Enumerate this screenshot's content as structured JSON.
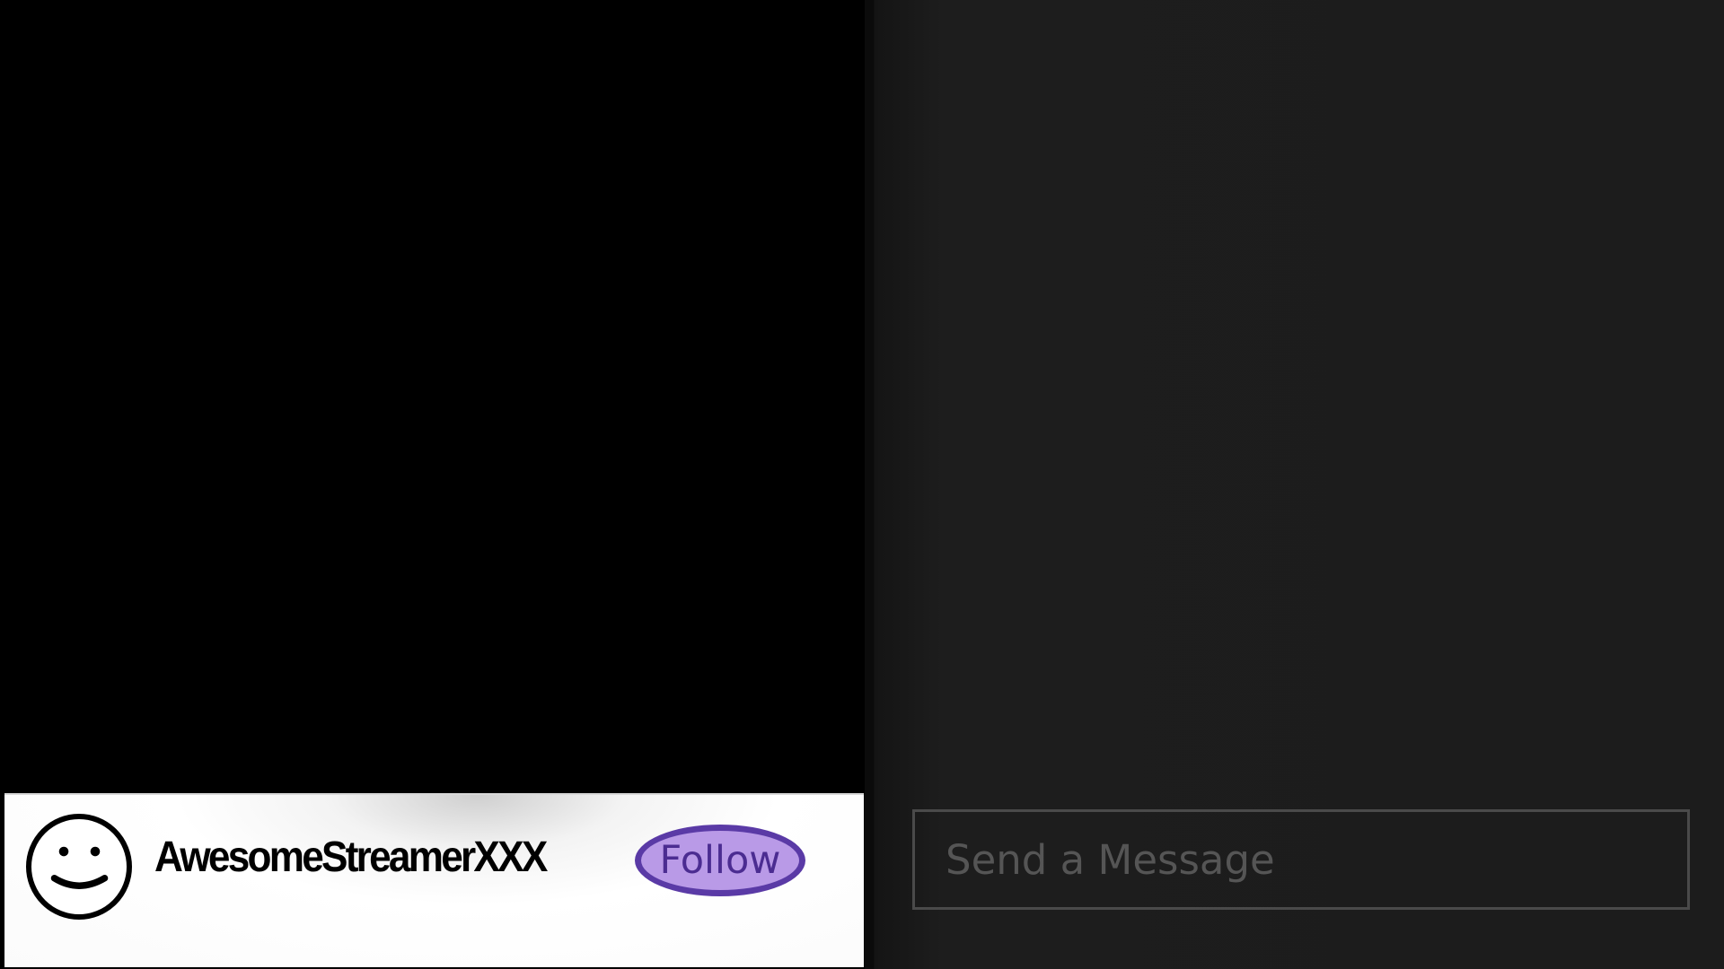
{
  "channel": {
    "streamer_name": "AwesomeStreamerXXX",
    "follow_label": "Follow",
    "avatar_icon": "smiley-face-icon"
  },
  "chat": {
    "message_placeholder": "Send a Message",
    "message_value": ""
  },
  "colors": {
    "video_background": "#000000",
    "chat_background": "#1c1c1c",
    "follow_fill": "#b99ae7",
    "follow_border": "#5a3aa6",
    "follow_text": "#4b2c91"
  }
}
